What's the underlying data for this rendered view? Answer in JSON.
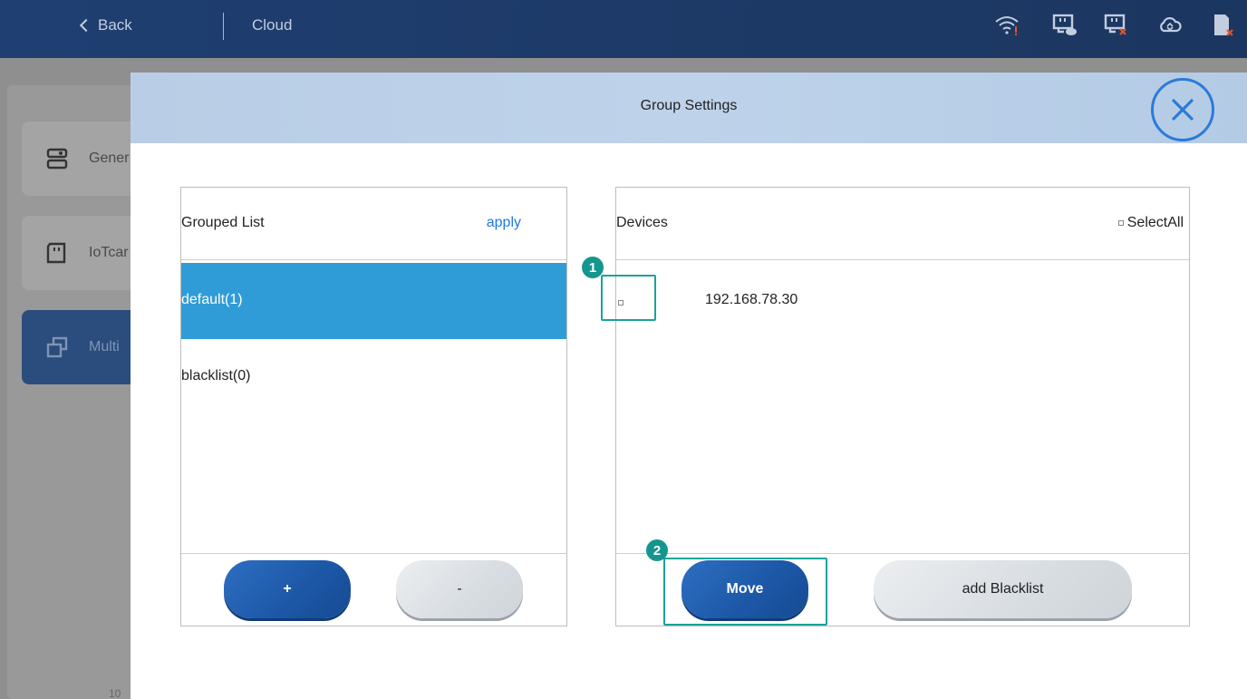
{
  "topbar": {
    "back_label": "Back",
    "title": "Cloud",
    "icons": [
      "wifi-warning-icon",
      "cloud-device-icon",
      "device-error-icon",
      "cloud-sync-icon",
      "sd-card-error-icon"
    ]
  },
  "sidebar": {
    "items": [
      {
        "label": "Gener",
        "icon": "settings-device-icon"
      },
      {
        "label": "IoTcar",
        "icon": "sd-card-icon"
      },
      {
        "label": "Multi",
        "icon": "multi-window-icon"
      }
    ],
    "footer_text": "10"
  },
  "modal": {
    "title": "Group Settings",
    "close_icon": "close-circle-icon",
    "grouped_list": {
      "header": "Grouped List",
      "apply_label": "apply",
      "items": [
        {
          "label": "default(1)",
          "selected": true
        },
        {
          "label": "blacklist(0)",
          "selected": false
        }
      ],
      "add_label": "+",
      "remove_label": "-"
    },
    "devices": {
      "header": "Devices",
      "select_all_label": "SelectAll",
      "items": [
        {
          "ip": "192.168.78.30",
          "checked": false
        }
      ],
      "move_label": "Move",
      "blacklist_label": "add Blacklist"
    }
  },
  "annotations": [
    {
      "number": "1"
    },
    {
      "number": "2"
    }
  ],
  "colors": {
    "topbar": "#1f3f72",
    "selected_row": "#2f9cd8",
    "accent_blue": "#1e7ae0",
    "annotation": "#1aa39a"
  }
}
